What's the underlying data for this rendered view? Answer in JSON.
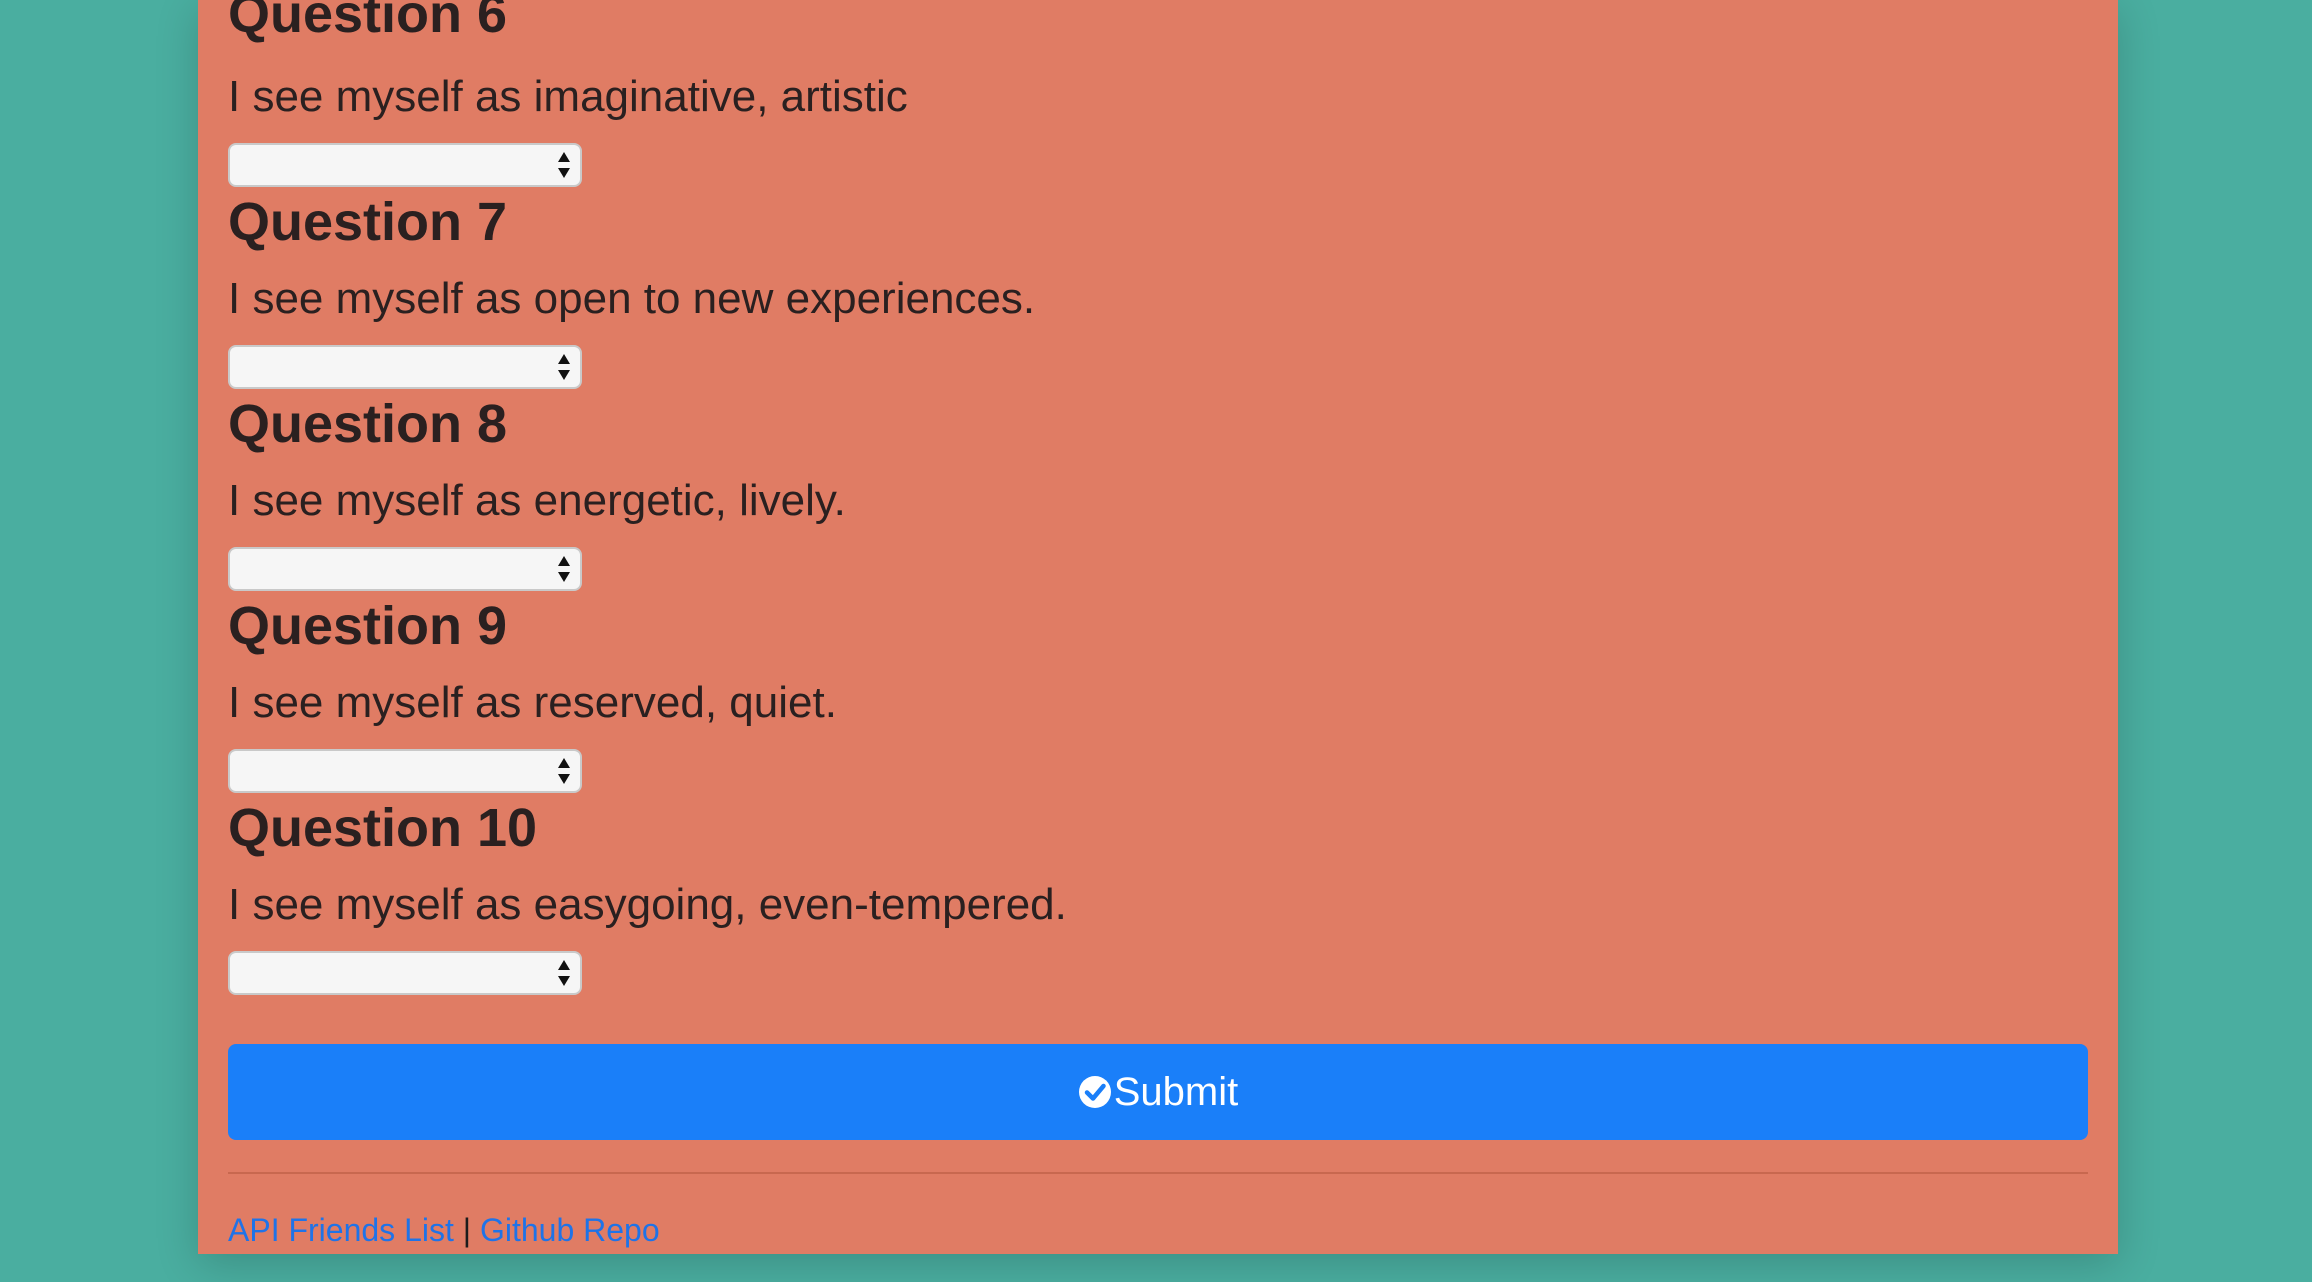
{
  "questions": [
    {
      "title": "Question 6",
      "text": "I see myself as imaginative, artistic",
      "selected": ""
    },
    {
      "title": "Question 7",
      "text": "I see myself as open to new experiences.",
      "selected": ""
    },
    {
      "title": "Question 8",
      "text": "I see myself as energetic, lively.",
      "selected": ""
    },
    {
      "title": "Question 9",
      "text": "I see myself as reserved, quiet.",
      "selected": ""
    },
    {
      "title": "Question 10",
      "text": "I see myself as easygoing, even-tempered.",
      "selected": ""
    }
  ],
  "submit": {
    "label": "Submit",
    "icon": "check-circle-icon"
  },
  "footer": {
    "link1": "API Friends List",
    "separator": "|",
    "link2": "Github Repo"
  },
  "colors": {
    "background": "#4aaea0",
    "card": "#e07c64",
    "button": "#1a7ff9",
    "link": "#1f73e8"
  }
}
